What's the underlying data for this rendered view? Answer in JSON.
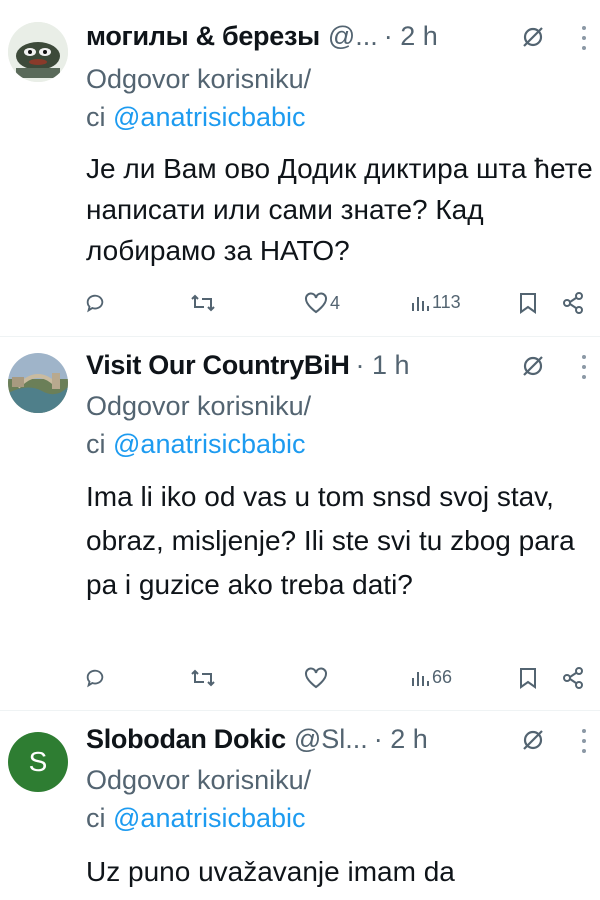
{
  "tweets": [
    {
      "name": "могилы & березы",
      "handle": "@...",
      "time": "· 2 h",
      "reply_prefix": "Odgovor korisniku/",
      "reply_prefix2": "ci",
      "mention": "@anatrisicbabic",
      "text": "Је ли Вам ово Додик диктира шта ћете написати или сами знате? Кад лобирамо за НАТО?",
      "likes": "4",
      "views": "113",
      "retweets": "",
      "replies": ""
    },
    {
      "name": "Visit Our CountryBiH",
      "handle": "",
      "time": "· 1 h",
      "reply_prefix": "Odgovor korisniku/",
      "reply_prefix2": "ci",
      "mention": "@anatrisicbabic",
      "text": "Ima li iko od vas u tom snsd svoj stav, obraz, misljenje? Ili ste svi tu zbog para pa i guzice ako treba dati?",
      "likes": "",
      "views": "66",
      "retweets": "",
      "replies": ""
    },
    {
      "name": "Slobodan Dokic",
      "handle": "@Sl...",
      "time": "· 2 h",
      "reply_prefix": "Odgovor korisniku/",
      "reply_prefix2": "ci",
      "mention": "@anatrisicbabic",
      "text": "Uz puno uvažavanje imam da",
      "avatar_letter": "S",
      "avatar_color": "#2e7d32"
    }
  ],
  "colors": {
    "secondary": "#536471",
    "link": "#1d9bf0",
    "divider": "#eff3f4"
  },
  "icons": [
    "reply-icon",
    "retweet-icon",
    "like-icon",
    "views-icon",
    "bookmark-icon",
    "share-icon",
    "grok-icon",
    "more-icon"
  ]
}
